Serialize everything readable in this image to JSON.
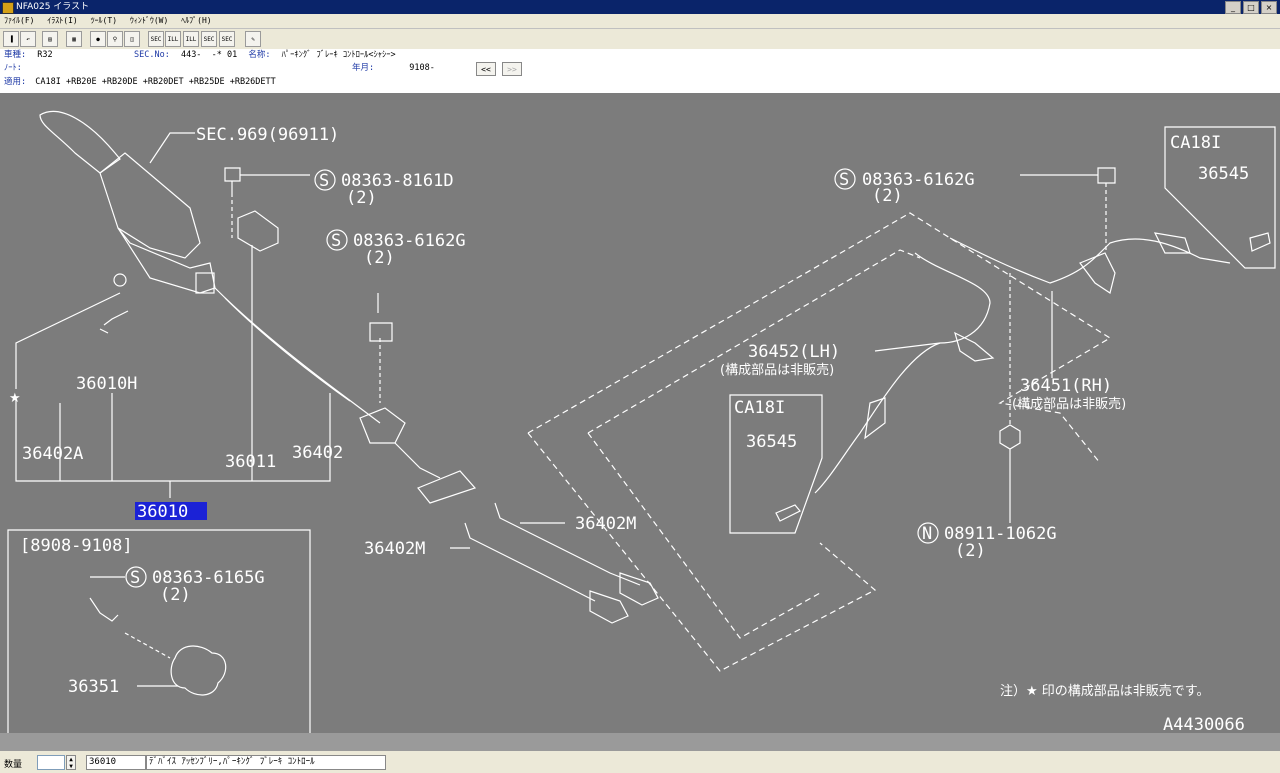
{
  "window": {
    "title": "NFA025 イラスト"
  },
  "menu": [
    "ﾌｧｲﾙ(F)",
    "ｲﾗｽﾄ(I)",
    "ﾂｰﾙ(T)",
    "ｳｨﾝﾄﾞｳ(W)",
    "ﾍﾙﾌﾟ(H)"
  ],
  "toolbar": {
    "sec_buttons": [
      "SEC",
      "ILL",
      "ILL",
      "SEC",
      "SEC"
    ]
  },
  "info": {
    "model_label": "車種:",
    "model_value": "R32",
    "sec_label": "SEC.No:",
    "sec_value": "443-  -* 01",
    "name_label": "名称:",
    "name_value": "ﾊﾟｰｷﾝｸﾞ ﾌﾞﾚｰｷ ｺﾝﾄﾛｰﾙ<ｼｬｼｰ>",
    "note_label": "ﾉｰﾄ:",
    "date_label": "年月:",
    "date_value": "9108-",
    "apply_label": "適用:",
    "apply_value": "CA18I +RB20E +RB20DE +RB20DET +RB25DE +RB26DETT",
    "prev_btn": "<<",
    "next_btn": ">>"
  },
  "diagram": {
    "labels": {
      "sec969": "SEC.969(96911)",
      "bolt_8161d": "08363-8161D",
      "bolt_8161d_qty": "(2)",
      "bolt_6162g_left": "08363-6162G",
      "bolt_6162g_left_qty": "(2)",
      "bolt_6162g_right": "08363-6162G",
      "bolt_6162g_right_qty": "(2)",
      "ca18i_top": "CA18I",
      "p36545_top": "36545",
      "p36452": "36452(LH)",
      "p36452_note": "(構成部品は非販売)",
      "p36451": "36451(RH)",
      "p36451_note": "(構成部品は非販売)",
      "ca18i_mid": "CA18I",
      "p36545_mid": "36545",
      "p36010h": "36010H",
      "p36402a": "36402A",
      "p36011": "36011",
      "p36402": "36402",
      "p36010": "36010",
      "p36402m_right": "36402M",
      "p36402m_left": "36402M",
      "nut_1062g": "08911-1062G",
      "nut_1062g_qty": "(2)",
      "date_range": "[8908-9108]",
      "bolt_6165g": "08363-6165G",
      "bolt_6165g_qty": "(2)",
      "p36351": "36351",
      "note": "注）★ 印の構成部品は非販売です。",
      "illust_no": "A4430066",
      "s_mark": "S",
      "n_mark": "N",
      "star": "★"
    }
  },
  "status": {
    "qty_label": "数量",
    "part_no": "36010",
    "part_name": "ﾃﾞﾊﾞｲｽ ｱｯｾﾝﾌﾞﾘｰ,ﾊﾟｰｷﾝｸﾞ ﾌﾞﾚｰｷ ｺﾝﾄﾛｰﾙ"
  }
}
